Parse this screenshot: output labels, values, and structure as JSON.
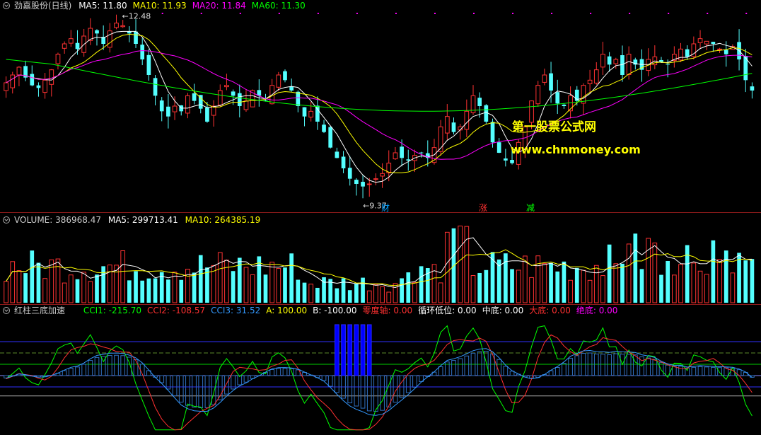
{
  "price_panel": {
    "title": "劲嘉股份(日线)",
    "ma": [
      {
        "label": "MA5: ",
        "value": "11.80",
        "color": "#ffffff"
      },
      {
        "label": "MA10: ",
        "value": "11.93",
        "color": "#ffff00"
      },
      {
        "label": "MA20: ",
        "value": "11.84",
        "color": "#ff00ff"
      },
      {
        "label": "MA60: ",
        "value": "11.30",
        "color": "#00ff00"
      }
    ],
    "high_label": "12.48",
    "low_label": "9.37",
    "event_tags": [
      {
        "text": "财",
        "color": "#00a0ff"
      },
      {
        "text": "涨",
        "color": "#ff3030"
      },
      {
        "text": "减",
        "color": "#00ff00"
      }
    ],
    "watermark_title": "第一股票公式网",
    "watermark_url": "www.chnmoney.com"
  },
  "volume_panel": {
    "title": "VOLUME: ",
    "value": "386968.47",
    "ma5_label": "MA5: ",
    "ma5_value": "299713.41",
    "ma10_label": "MA10: ",
    "ma10_value": "264385.19"
  },
  "indicator_panel": {
    "title": "红柱三底加速",
    "params": [
      {
        "label": "CCI1: ",
        "value": "-215.70",
        "color": "#00ff00"
      },
      {
        "label": "CCI2: ",
        "value": "-108.57",
        "color": "#ff3030"
      },
      {
        "label": "CCI3: ",
        "value": "31.52",
        "color": "#3399ff"
      },
      {
        "label": "A: ",
        "value": "100.00",
        "color": "#ffff00"
      },
      {
        "label": "B: ",
        "value": "-100.00",
        "color": "#ffffff"
      },
      {
        "label": "零度轴: ",
        "value": "0.00",
        "color": "#ff3030"
      },
      {
        "label": "循环低位: ",
        "value": "0.00",
        "color": "#ffffff"
      },
      {
        "label": "中底: ",
        "value": "0.00",
        "color": "#ffffff"
      },
      {
        "label": "大底: ",
        "value": "0.00",
        "color": "#ff3030"
      },
      {
        "label": "绝底: ",
        "value": "0.00",
        "color": "#ff00ff"
      }
    ]
  },
  "colors": {
    "up": "#ff3232",
    "down": "#54ffff",
    "ma5": "#ffffff",
    "ma10": "#ffff00",
    "ma20": "#ff00ff",
    "ma60": "#00ff00",
    "bg": "#000000",
    "separator": "#8b1a1a"
  },
  "chart_data": {
    "type": "candlestick",
    "closes": [
      11.45,
      11.6,
      11.75,
      11.55,
      11.4,
      11.35,
      11.5,
      11.7,
      12.0,
      12.2,
      12.3,
      12.1,
      12.35,
      12.5,
      12.4,
      12.2,
      12.45,
      12.6,
      12.55,
      12.4,
      12.2,
      11.9,
      11.6,
      11.2,
      10.9,
      10.8,
      11.0,
      10.9,
      11.2,
      11.1,
      10.95,
      10.7,
      11.0,
      11.3,
      11.4,
      11.2,
      11.0,
      11.1,
      11.3,
      11.2,
      11.1,
      11.4,
      11.6,
      11.5,
      11.3,
      11.0,
      10.8,
      10.9,
      10.7,
      10.5,
      10.2,
      10.0,
      9.8,
      9.6,
      9.5,
      9.45,
      9.5,
      9.6,
      9.7,
      9.9,
      10.1,
      10.0,
      9.95,
      10.05,
      10.1,
      10.0,
      10.2,
      10.6,
      10.8,
      10.5,
      10.6,
      10.9,
      11.2,
      11.0,
      10.7,
      10.3,
      10.1,
      9.95,
      9.9,
      10.3,
      10.6,
      11.1,
      11.4,
      11.6,
      11.3,
      11.05,
      11.0,
      11.2,
      11.1,
      11.4,
      11.5,
      11.7,
      12.0,
      11.8,
      11.9,
      11.6,
      12.0,
      11.8,
      11.7,
      11.9,
      11.95,
      11.85,
      11.8,
      12.0,
      12.1,
      11.95,
      12.2,
      12.3,
      12.25,
      12.2,
      12.1,
      12.0,
      12.15,
      11.9,
      11.5,
      11.3
    ],
    "y_range": [
      9.2,
      12.8
    ],
    "labels": [
      "12.48",
      "9.37"
    ]
  }
}
